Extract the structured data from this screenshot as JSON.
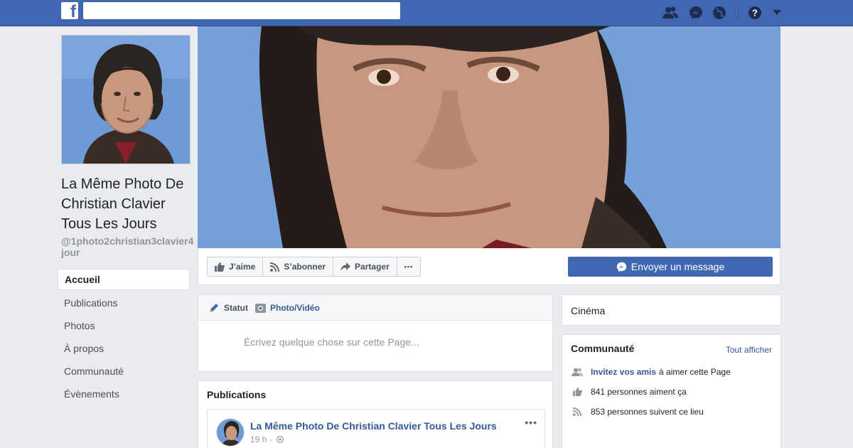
{
  "topbar": {
    "logo_letter": "f",
    "search_placeholder": "",
    "icons": [
      "friend-requests-icon",
      "messenger-icon",
      "notifications-globe-icon",
      "help-icon",
      "account-menu-chevron-icon"
    ]
  },
  "page": {
    "name": "La Même Photo De Christian Clavier Tous Les Jours",
    "handle": "@1photo2christian3clavier4jour"
  },
  "nav": {
    "items": [
      {
        "label": "Accueil",
        "active": true
      },
      {
        "label": "Publications"
      },
      {
        "label": "Photos"
      },
      {
        "label": "À propos"
      },
      {
        "label": "Communauté"
      },
      {
        "label": "Évènements"
      }
    ]
  },
  "actions": {
    "like": "J’aime",
    "subscribe": "S’abonner",
    "share": "Partager",
    "more": "•••",
    "message": "Envoyer un message"
  },
  "composer": {
    "tab_status": "Statut",
    "tab_photo": "Photo/Vidéo",
    "placeholder": "Écrivez quelque chose sur cette Page..."
  },
  "publications": {
    "title": "Publications",
    "post": {
      "author": "La Même Photo De Christian Clavier Tous Les Jours",
      "time": "19 h ·",
      "more": "•••"
    }
  },
  "category": "Cinéma",
  "community": {
    "title": "Communauté",
    "see_all": "Tout afficher",
    "invite_link": "Invitez vos amis",
    "invite_rest": "à aimer cette Page",
    "likes": "841 personnes aiment ça",
    "follows": "853 personnes suivent ce lieu"
  },
  "colors": {
    "brand": "#4267b2",
    "link": "#365899",
    "background": "#e9ebee"
  }
}
